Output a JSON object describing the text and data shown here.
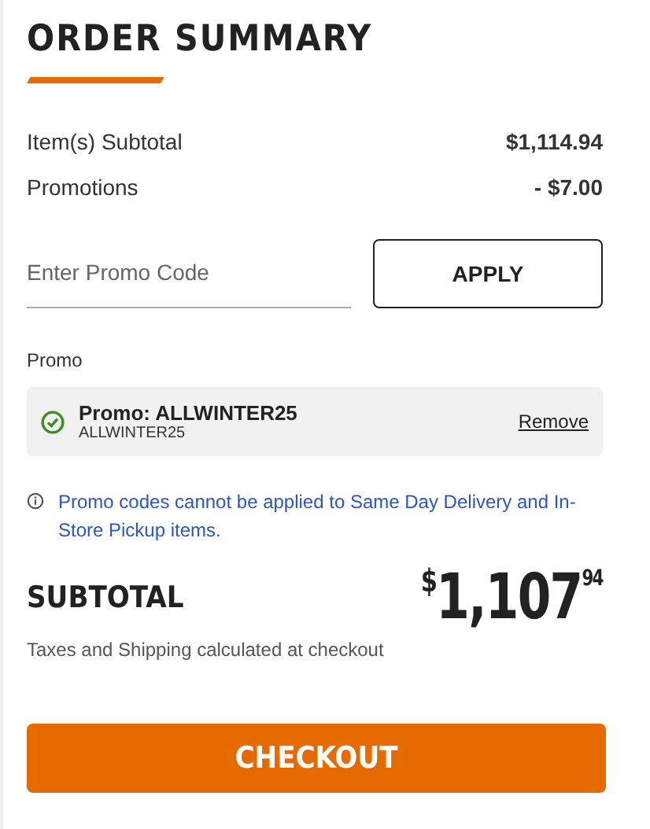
{
  "title": "ORDER SUMMARY",
  "lines": [
    {
      "label": "Item(s) Subtotal",
      "value": "$1,114.94"
    },
    {
      "label": "Promotions",
      "value": "- $7.00"
    }
  ],
  "promo_field": {
    "placeholder": "Enter Promo Code"
  },
  "apply_button": "APPLY",
  "promo_section": {
    "label": "Promo",
    "applied": {
      "title": "Promo: ALLWINTER25",
      "code": "ALLWINTER25",
      "valid": true,
      "remove_link": "Remove"
    }
  },
  "notice": "Promo codes cannot be applied to Same Day Delivery and In-Store Pickup items.",
  "subtotal": {
    "label": "SUBTOTAL",
    "currency": "$",
    "whole": "1,107",
    "cents": "94"
  },
  "tax_note": "Taxes and Shipping calculated at checkout",
  "checkout_button": "CHECKOUT"
}
